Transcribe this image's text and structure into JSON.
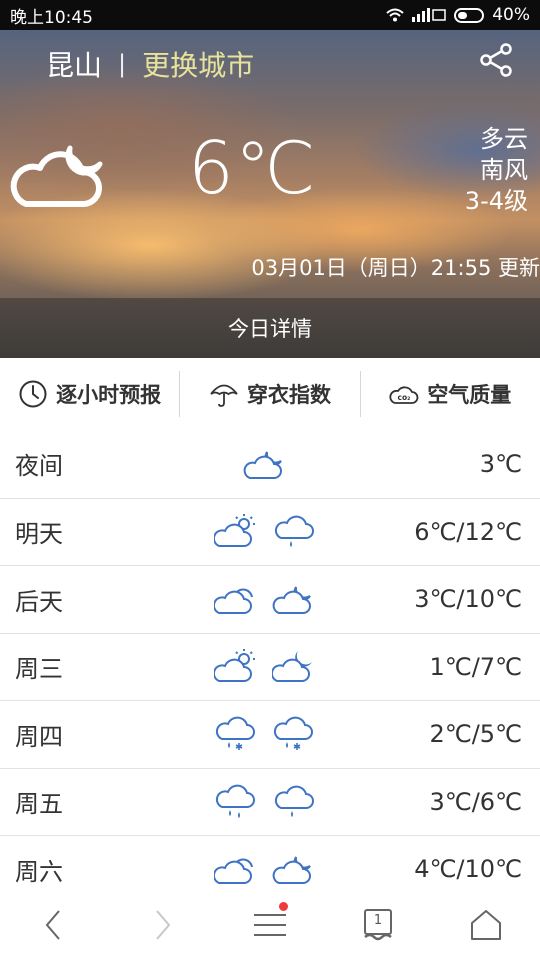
{
  "status": {
    "time": "晚上10:45",
    "signal_text": "",
    "battery": "40%"
  },
  "header": {
    "city": "昆山",
    "separator": "|",
    "change_city": "更换城市"
  },
  "current": {
    "temperature": "6℃",
    "condition": "多云",
    "wind_direction": "南风",
    "wind_level": "3-4级",
    "updated": "03月01日（周日）21:55 更新"
  },
  "today_detail": "今日详情",
  "tabs": [
    {
      "label": "逐小时预报",
      "icon": "clock-icon"
    },
    {
      "label": "穿衣指数",
      "icon": "umbrella-icon"
    },
    {
      "label": "空气质量",
      "icon": "co2-cloud-icon"
    }
  ],
  "forecast": [
    {
      "day": "夜间",
      "temps": "3℃",
      "icons": [
        "cloud-moon-icon"
      ]
    },
    {
      "day": "明天",
      "temps": "6℃/12℃",
      "icons": [
        "cloud-sun-icon",
        "rain-cloud-icon"
      ]
    },
    {
      "day": "后天",
      "temps": "3℃/10℃",
      "icons": [
        "cloud-icon",
        "cloud-moon-icon"
      ]
    },
    {
      "day": "周三",
      "temps": "1℃/7℃",
      "icons": [
        "cloud-sun-icon",
        "cloud-moon-icon"
      ]
    },
    {
      "day": "周四",
      "temps": "2℃/5℃",
      "icons": [
        "sleet-cloud-icon",
        "sleet-cloud-icon"
      ]
    },
    {
      "day": "周五",
      "temps": "3℃/6℃",
      "icons": [
        "rain-cloud-icon",
        "rain-cloud-icon"
      ]
    },
    {
      "day": "周六",
      "temps": "4℃/10℃",
      "icons": [
        "cloud-icon",
        "cloud-moon-icon"
      ]
    }
  ],
  "nav": {
    "tabs_count": "1"
  },
  "colors": {
    "icon_blue": "#3f73c4",
    "change_city": "#e8e39a",
    "notification_dot": "#f03a3a"
  }
}
